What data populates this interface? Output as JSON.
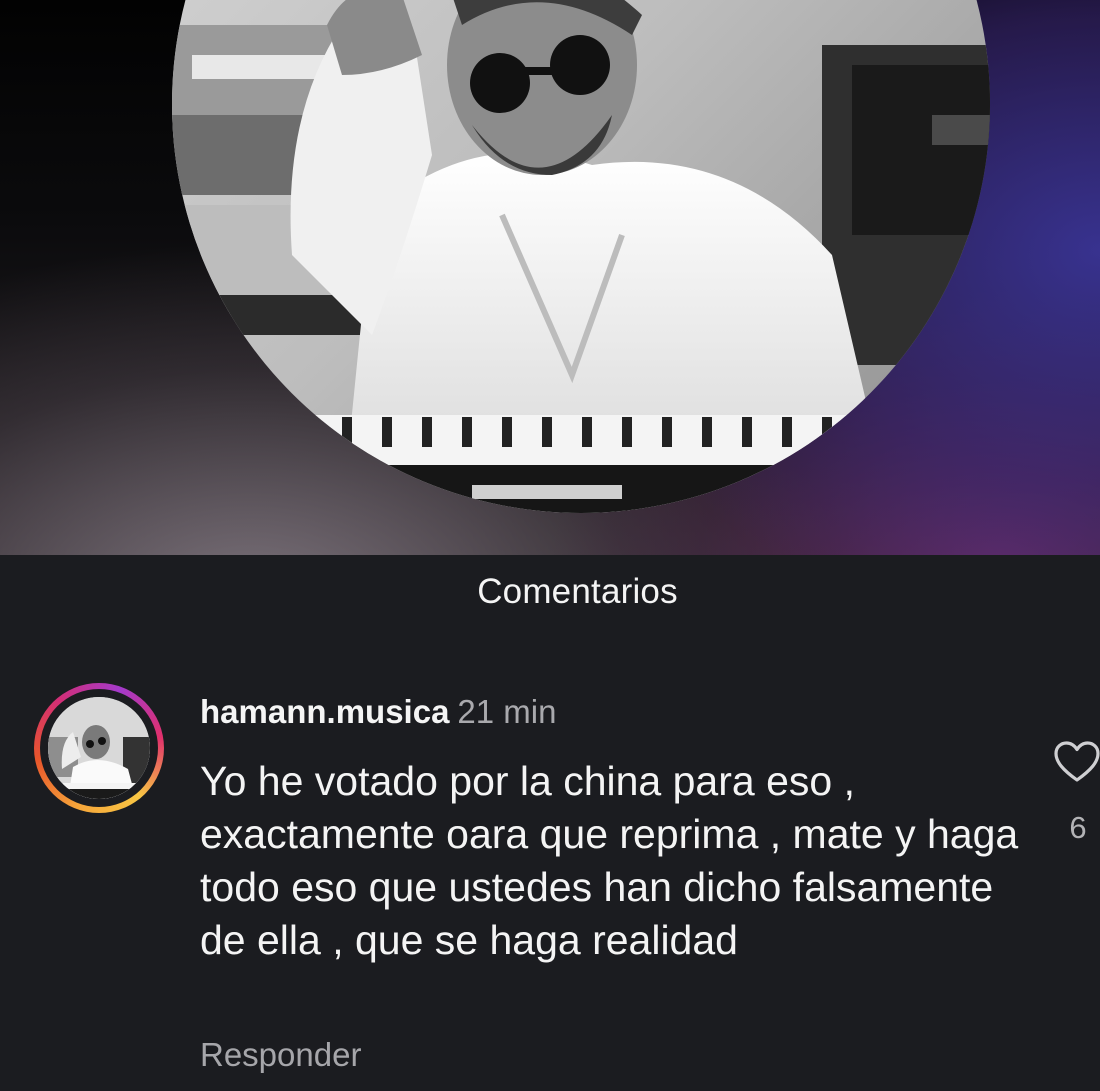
{
  "section_title": "Comentarios",
  "comment": {
    "username": "hamann.musica",
    "time": "21 min",
    "text": "Yo he votado por la china para eso , exactamente oara que reprima , mate y haga todo eso que ustedes han dicho falsamente de ella , que se haga realidad",
    "reply_label": "Responder",
    "like_icon": "heart-icon",
    "like_count": "6"
  },
  "avatar": {
    "has_story_ring": true
  },
  "colors": {
    "background": "#1b1c20",
    "text_primary": "#f4f4f4",
    "text_secondary": "#a6a6aa",
    "story_ring": [
      "#f6a53a",
      "#e8552b",
      "#d32e76",
      "#a43acb"
    ]
  }
}
